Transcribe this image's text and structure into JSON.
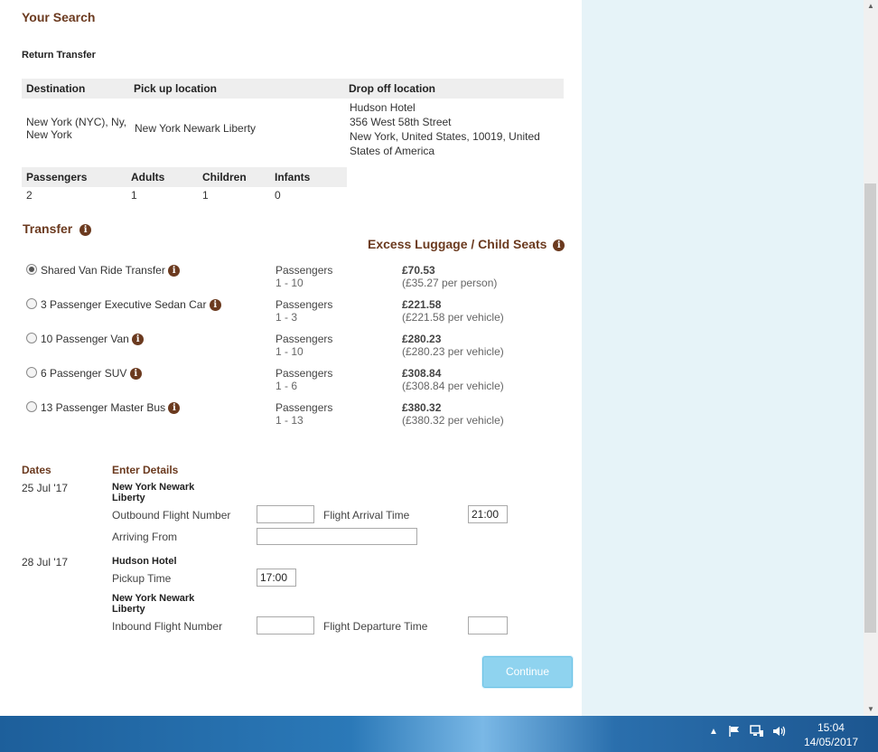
{
  "search": {
    "heading": "Your Search",
    "subheading": "Return Transfer",
    "location_headers": [
      "Destination",
      "Pick up location",
      "Drop off location"
    ],
    "destination": "New York (NYC), Ny, New York",
    "pickup": "New York Newark Liberty",
    "dropoff_name": "Hudson Hotel",
    "dropoff_street": "356 West 58th Street",
    "dropoff_city": "New York, United States, 10019, United States of America",
    "passenger_headers": [
      "Passengers",
      "Adults",
      "Children",
      "Infants"
    ],
    "passenger_values": [
      "2",
      "1",
      "1",
      "0"
    ]
  },
  "transfer": {
    "heading": "Transfer",
    "excess_heading": "Excess Luggage / Child Seats",
    "options": [
      {
        "name": "Shared Van Ride Transfer",
        "pax_label": "Passengers",
        "pax_range": "1 - 10",
        "price": "£70.53",
        "price_note": "(£35.27 per person)",
        "selected": true
      },
      {
        "name": "3 Passenger Executive Sedan Car",
        "pax_label": "Passengers",
        "pax_range": "1 - 3",
        "price": "£221.58",
        "price_note": "(£221.58 per vehicle)",
        "selected": false
      },
      {
        "name": "10 Passenger Van",
        "pax_label": "Passengers",
        "pax_range": "1 - 10",
        "price": "£280.23",
        "price_note": "(£280.23 per vehicle)",
        "selected": false
      },
      {
        "name": "6 Passenger SUV",
        "pax_label": "Passengers",
        "pax_range": "1 - 6",
        "price": "£308.84",
        "price_note": "(£308.84 per vehicle)",
        "selected": false
      },
      {
        "name": "13 Passenger Master Bus",
        "pax_label": "Passengers",
        "pax_range": "1 - 13",
        "price": "£380.32",
        "price_note": "(£380.32 per vehicle)",
        "selected": false
      }
    ]
  },
  "details": {
    "dates_heading": "Dates",
    "enter_heading": "Enter Details",
    "outbound_date": "25 Jul '17",
    "outbound_location": "New York Newark Liberty",
    "outbound_flight_label": "Outbound Flight Number",
    "outbound_flight_value": "",
    "arrival_time_label": "Flight Arrival Time",
    "arrival_time_value": "21:00",
    "arriving_from_label": "Arriving From",
    "arriving_from_value": "",
    "return_date": "28 Jul '17",
    "return_location": "Hudson Hotel",
    "pickup_time_label": "Pickup Time",
    "pickup_time_value": "17:00",
    "return_airport": "New York Newark Liberty",
    "inbound_flight_label": "Inbound Flight Number",
    "inbound_flight_value": "",
    "departure_time_label": "Flight Departure Time",
    "departure_time_value": ""
  },
  "continue_label": "Continue",
  "taskbar": {
    "time": "15:04",
    "date": "14/05/2017",
    "tray_icons": [
      "chevron-up-icon",
      "flag-icon",
      "network-icon",
      "speaker-icon"
    ]
  },
  "colors": {
    "heading": "#6b3a1f",
    "side_panel": "#e6f3f8",
    "button": "#8fd3ef"
  }
}
